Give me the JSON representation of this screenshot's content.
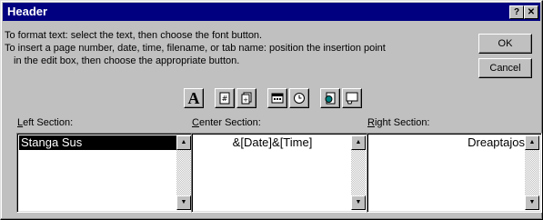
{
  "window": {
    "title": "Header",
    "help_glyph": "?",
    "close_glyph": "✕"
  },
  "instructions": {
    "line1": "To format text:  select the text, then choose the font button.",
    "line2": "To insert a page number, date, time, filename, or tab name:  position the insertion point",
    "line3": "in the edit box, then choose the appropriate button."
  },
  "buttons": {
    "ok": "OK",
    "cancel": "Cancel"
  },
  "toolbar": {
    "font": {
      "glyph": "A",
      "icon": "font-icon"
    },
    "page_number": {
      "icon": "page-number-icon"
    },
    "total_pages": {
      "icon": "total-pages-icon"
    },
    "date": {
      "icon": "date-icon"
    },
    "time": {
      "icon": "time-icon"
    },
    "filename": {
      "icon": "filename-icon"
    },
    "tab_name": {
      "icon": "tab-name-icon"
    }
  },
  "sections": {
    "left": {
      "label_u": "L",
      "label_rest": "eft Section:",
      "value": "Stanga Sus"
    },
    "center": {
      "label_u": "C",
      "label_rest": "enter Section:",
      "value": "&[Date]&[Time]"
    },
    "right": {
      "label_u": "R",
      "label_rest": "ight Section:",
      "value": "Dreaptajos"
    }
  },
  "colors": {
    "title_bar": "#000080",
    "face": "#c0c0c0",
    "selection": "#000000"
  }
}
